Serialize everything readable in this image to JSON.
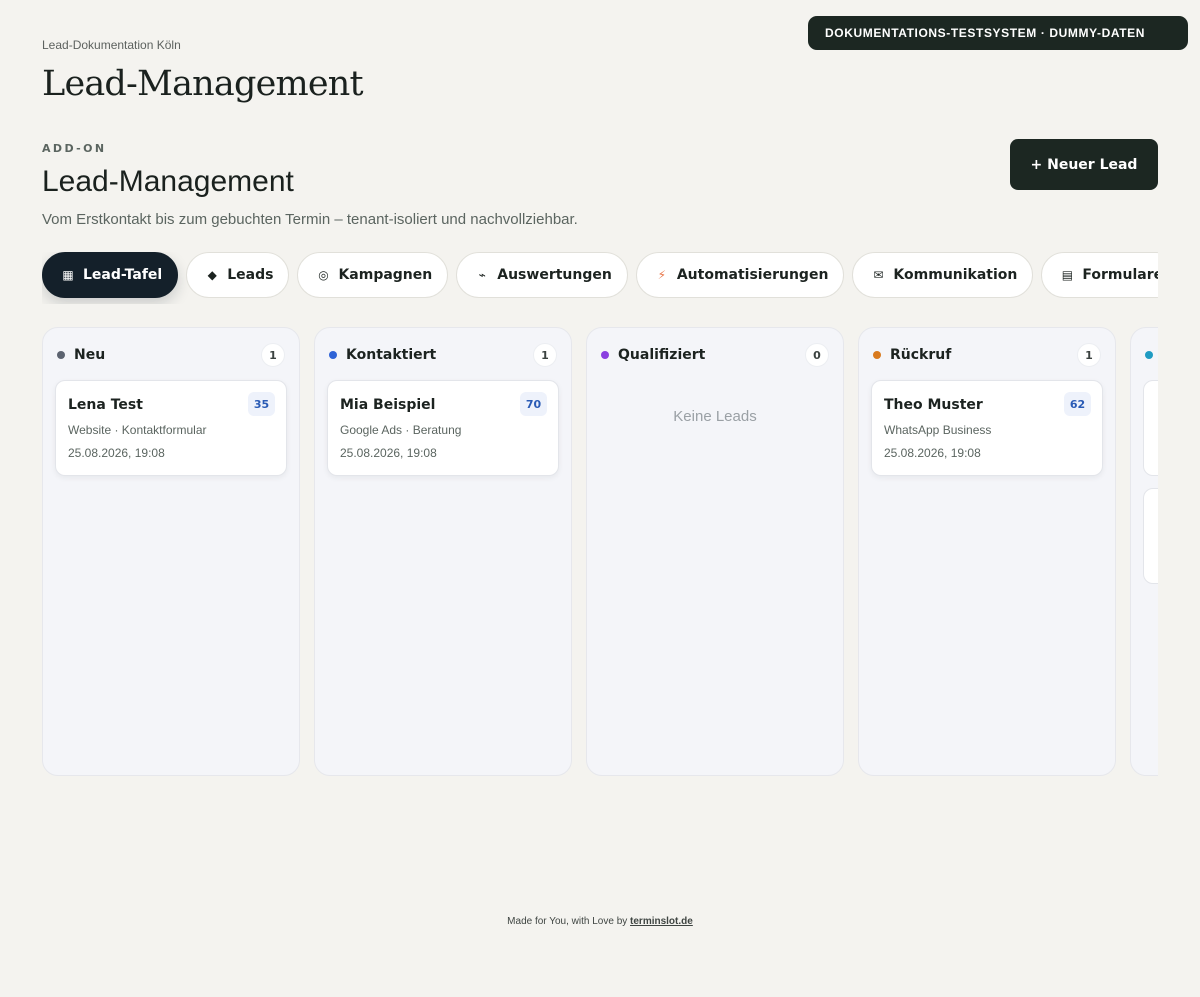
{
  "env_badge": "DOKUMENTATIONS-TESTSYSTEM · DUMMY-DATEN",
  "breadcrumb": "Lead-Dokumentation Köln",
  "page_title": "Lead-Management",
  "section": {
    "eyebrow": "ADD-ON",
    "title": "Lead-Management",
    "description": "Vom Erstkontakt bis zum gebuchten Termin – tenant-isoliert und nachvollziehbar.",
    "new_lead_label": "+ Neuer Lead"
  },
  "tabs": [
    {
      "label": "Lead-Tafel",
      "icon": "grid-icon",
      "glyph": "▦",
      "active": true
    },
    {
      "label": "Leads",
      "icon": "diamond-icon",
      "glyph": "◆",
      "active": false
    },
    {
      "label": "Kampagnen",
      "icon": "target-icon",
      "glyph": "◎",
      "active": false
    },
    {
      "label": "Auswertungen",
      "icon": "trend-icon",
      "glyph": "⌁",
      "active": false
    },
    {
      "label": "Automatisierungen",
      "icon": "lightning-icon",
      "glyph": "⚡",
      "active": false
    },
    {
      "label": "Kommunikation",
      "icon": "mail-icon",
      "glyph": "✉",
      "active": false
    },
    {
      "label": "Formulare",
      "icon": "form-icon",
      "glyph": "▤",
      "active": false
    },
    {
      "label": "",
      "icon": "command-icon",
      "glyph": "⌘",
      "active": false
    }
  ],
  "columns": [
    {
      "name": "Neu",
      "count": "1",
      "color": "#5c6370",
      "cards": [
        {
          "name": "Lena Test",
          "score": "35",
          "source": "Website · Kontaktformular",
          "date": "25.08.2026, 19:08"
        }
      ]
    },
    {
      "name": "Kontaktiert",
      "count": "1",
      "color": "#2f63d6",
      "cards": [
        {
          "name": "Mia Beispiel",
          "score": "70",
          "source": "Google Ads · Beratung",
          "date": "25.08.2026, 19:08"
        }
      ]
    },
    {
      "name": "Qualifiziert",
      "count": "0",
      "color": "#8a3fe0",
      "cards": [],
      "empty_text": "Keine Leads"
    },
    {
      "name": "Rückruf",
      "count": "1",
      "color": "#d97a1e",
      "cards": [
        {
          "name": "Theo Muster",
          "score": "62",
          "source": "WhatsApp Business",
          "date": "25.08.2026, 19:08"
        }
      ]
    },
    {
      "name": "",
      "count": "",
      "color": "#1f9bc2",
      "cards": [],
      "partial": true
    }
  ],
  "footer": {
    "text": "Made for You, with Love by ",
    "link": "terminslot.de"
  }
}
